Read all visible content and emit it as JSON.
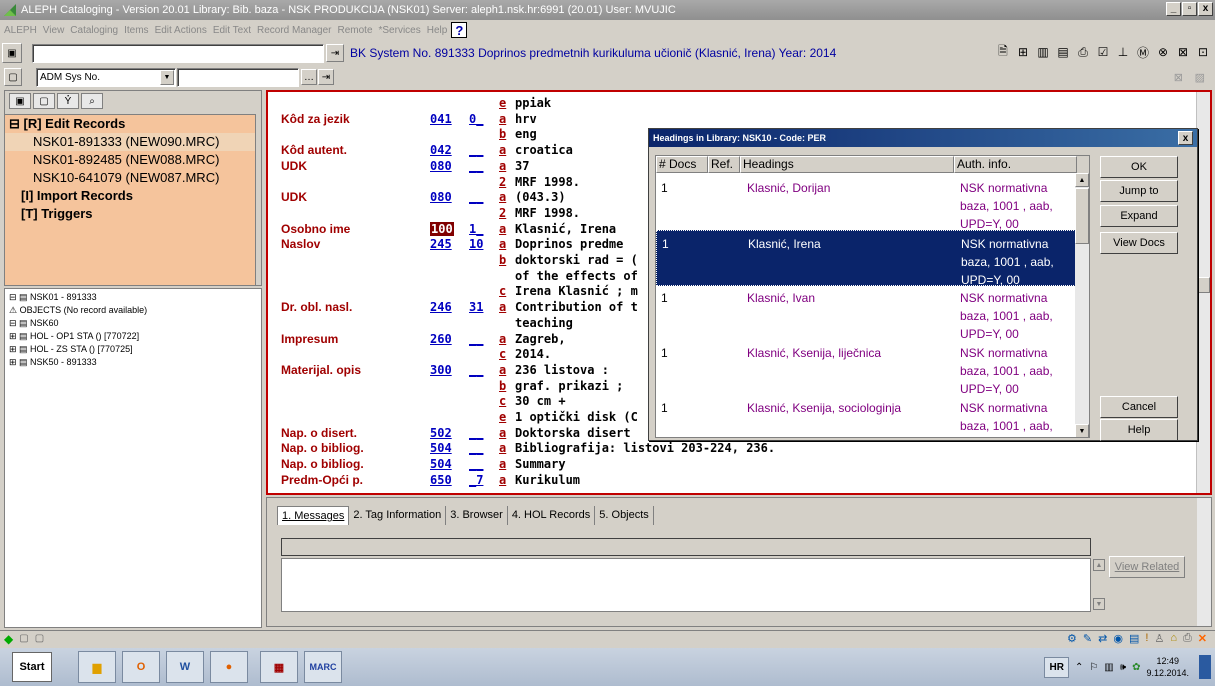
{
  "app": {
    "title": "ALEPH Cataloging - Version 20.01  Library:  Bib. baza - NSK PRODUKCIJA (NSK01)  Server:  aleph1.nsk.hr:6991 (20.01)  User:  MVUJIC",
    "window_buttons": [
      "_",
      "▫",
      "x"
    ]
  },
  "menu": [
    "ALEPH",
    "View",
    "Cataloging",
    "Items",
    "Edit Actions",
    "Edit Text",
    "Record Manager",
    "Remote",
    "*Services",
    "Help"
  ],
  "toolbar": {
    "record_line": "BK System No. 891333 Doprinos predmetnih kurikuluma učionič (Klasnić, Irena) Year: 2014",
    "search_select": "ADM Sys No."
  },
  "left_panel": {
    "items": [
      {
        "label": "[R] Edit Records",
        "bold": true
      },
      {
        "label": "NSK01-891333 (NEW090.MRC)",
        "bold": false
      },
      {
        "label": "NSK01-892485 (NEW088.MRC)",
        "bold": false
      },
      {
        "label": "NSK10-641079 (NEW087.MRC)",
        "bold": false
      },
      {
        "label": "[I] Import Records",
        "bold": true
      },
      {
        "label": "[T] Triggers",
        "bold": true
      }
    ]
  },
  "tree": [
    "⊟ ▤ NSK01 - 891333",
    "    ⚠ OBJECTS (No record available)",
    "  ⊟ ▤ NSK60",
    "      ⊞ ▤ HOL - OP1 STA () [770722]",
    "      ⊞ ▤ HOL - ZS STA () [770725]",
    "  ⊞ ▤ NSK50 - 891333"
  ],
  "record": [
    {
      "label": "",
      "tag": "",
      "ind": "",
      "sf": "e",
      "value": "ppiak"
    },
    {
      "label": "Kôd za jezik",
      "tag": "041",
      "ind": "0_",
      "sf": "a",
      "value": "hrv"
    },
    {
      "label": "",
      "tag": "",
      "ind": "",
      "sf": "b",
      "value": "eng"
    },
    {
      "label": "Kôd autent.",
      "tag": "042",
      "ind": "__",
      "sf": "a",
      "value": "croatica"
    },
    {
      "label": "UDK",
      "tag": "080",
      "ind": "__",
      "sf": "a",
      "value": "37"
    },
    {
      "label": "",
      "tag": "",
      "ind": "",
      "sf": "2",
      "value": "MRF 1998."
    },
    {
      "label": "UDK",
      "tag": "080",
      "ind": "__",
      "sf": "a",
      "value": "(043.3)"
    },
    {
      "label": "",
      "tag": "",
      "ind": "",
      "sf": "2",
      "value": "MRF 1998."
    },
    {
      "label": "Osobno ime",
      "tag": "100",
      "ind": "1_",
      "sf": "a",
      "value": "Klasnić, Irena"
    },
    {
      "label": "Naslov",
      "tag": "245",
      "ind": "10",
      "sf": "a",
      "value": "Doprinos predme"
    },
    {
      "label": "",
      "tag": "",
      "ind": "",
      "sf": "b",
      "value": "doktorski rad = ("
    },
    {
      "label": "",
      "tag": "",
      "ind": "",
      "sf": "",
      "value": "of the effects of"
    },
    {
      "label": "",
      "tag": "",
      "ind": "",
      "sf": "c",
      "value": "Irena Klasnić ; m"
    },
    {
      "label": "Dr. obl. nasl.",
      "tag": "246",
      "ind": "31",
      "sf": "a",
      "value": "Contribution of t"
    },
    {
      "label": "",
      "tag": "",
      "ind": "",
      "sf": "",
      "value": "teaching"
    },
    {
      "label": "Impresum",
      "tag": "260",
      "ind": "__",
      "sf": "a",
      "value": "Zagreb,"
    },
    {
      "label": "",
      "tag": "",
      "ind": "",
      "sf": "c",
      "value": "2014."
    },
    {
      "label": "Materijal. opis",
      "tag": "300",
      "ind": "__",
      "sf": "a",
      "value": "236 listova :"
    },
    {
      "label": "",
      "tag": "",
      "ind": "",
      "sf": "b",
      "value": "graf. prikazi ;"
    },
    {
      "label": "",
      "tag": "",
      "ind": "",
      "sf": "c",
      "value": "30 cm +"
    },
    {
      "label": "",
      "tag": "",
      "ind": "",
      "sf": "e",
      "value": "1 optički disk (C"
    },
    {
      "label": "Nap. o disert.",
      "tag": "502",
      "ind": "__",
      "sf": "a",
      "value": "Doktorska disert"
    },
    {
      "label": "Nap. o bibliog.",
      "tag": "504",
      "ind": "__",
      "sf": "a",
      "value": "Bibliografija: listovi 203-224, 236."
    },
    {
      "label": "Nap. o bibliog.",
      "tag": "504",
      "ind": "__",
      "sf": "a",
      "value": "Summary"
    },
    {
      "label": "Predm-Opći p.",
      "tag": "650",
      "ind": "_7",
      "sf": "a",
      "value": "Kurikulum"
    }
  ],
  "dialog": {
    "title": "Headings in Library: NSK10 - Code: PER",
    "columns": [
      "# Docs",
      "Ref.",
      "Headings",
      "Auth. info."
    ],
    "rows": [
      {
        "docs": "1",
        "heading": "Klasnić, Dorijan",
        "auth": "NSK normativna baza, 1001 , aab, UPD=Y, 00"
      },
      {
        "docs": "1",
        "heading": "Klasnić, Irena",
        "auth": "NSK normativna baza, 1001 , aab, UPD=Y, 00"
      },
      {
        "docs": "1",
        "heading": "Klasnić, Ivan",
        "auth": "NSK normativna baza, 1001 , aab, UPD=Y, 00"
      },
      {
        "docs": "1",
        "heading": "Klasnić, Ksenija, liječnica",
        "auth": "NSK normativna baza, 1001 , aab, UPD=Y, 00"
      },
      {
        "docs": "1",
        "heading": "Klasnić, Ksenija, sociologinja",
        "auth": "NSK normativna baza, 1001 , aab, UPD=Y, 00"
      }
    ],
    "selected_index": 1,
    "buttons": {
      "ok": "OK",
      "jump": "Jump to",
      "expand": "Expand",
      "view_docs": "View Docs",
      "cancel": "Cancel",
      "help": "Help"
    }
  },
  "bottom": {
    "tabs": [
      "1. Messages",
      "2. Tag Information",
      "3. Browser",
      "4. HOL Records",
      "5. Objects"
    ],
    "view_related": "View Related"
  },
  "taskbar": {
    "start": "Start",
    "lang": "HR",
    "time": "12:49",
    "date": "9.12.2014."
  }
}
